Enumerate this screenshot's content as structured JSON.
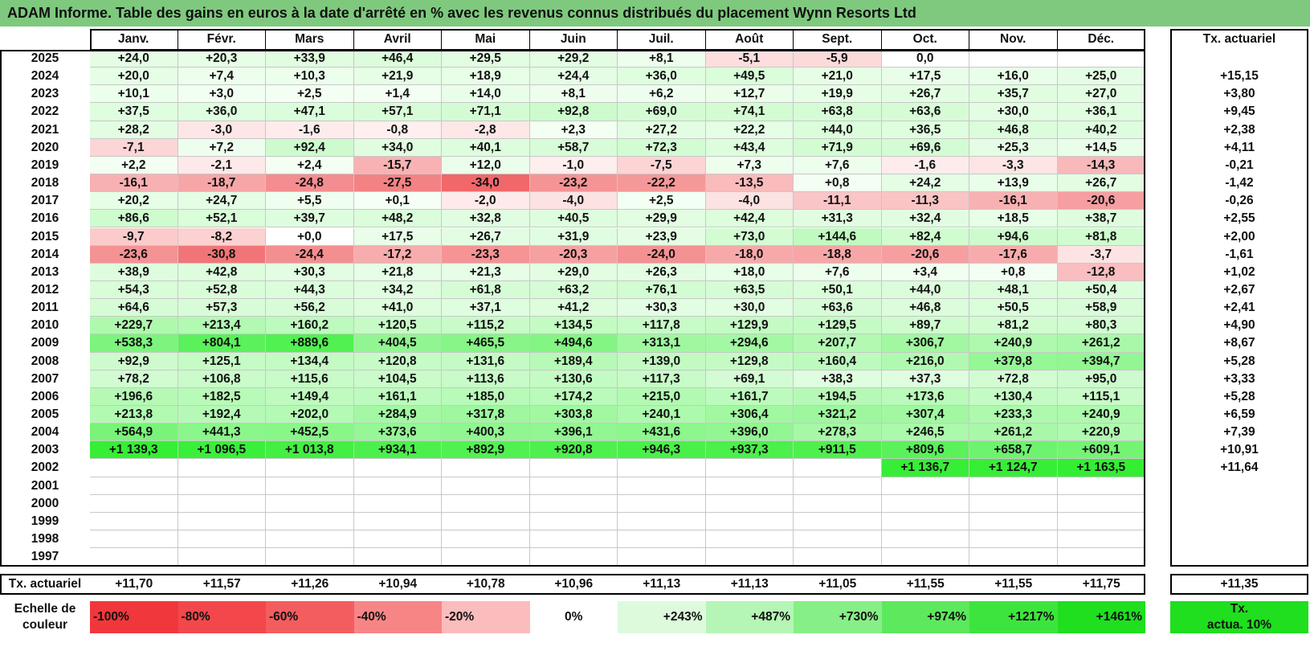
{
  "title": "ADAM Informe. Table des gains en euros à la date d'arrêté en % avec les revenus connus distribués du placement Wynn Resorts Ltd",
  "months": [
    "Janv.",
    "Févr.",
    "Mars",
    "Avril",
    "Mai",
    "Juin",
    "Juil.",
    "Août",
    "Sept.",
    "Oct.",
    "Nov.",
    "Déc."
  ],
  "actuarial_header": "Tx. actuariel",
  "rows": [
    {
      "year": "2025",
      "values": [
        "+24,0",
        "+20,3",
        "+33,9",
        "+46,4",
        "+29,5",
        "+29,2",
        "+8,1",
        "-5,1",
        "-5,9",
        "0,0",
        "",
        ""
      ],
      "rate": ""
    },
    {
      "year": "2024",
      "values": [
        "+20,0",
        "+7,4",
        "+10,3",
        "+21,9",
        "+18,9",
        "+24,4",
        "+36,0",
        "+49,5",
        "+21,0",
        "+17,5",
        "+16,0",
        "+25,0"
      ],
      "rate": "+15,15"
    },
    {
      "year": "2023",
      "values": [
        "+10,1",
        "+3,0",
        "+2,5",
        "+1,4",
        "+14,0",
        "+8,1",
        "+6,2",
        "+12,7",
        "+19,9",
        "+26,7",
        "+35,7",
        "+27,0"
      ],
      "rate": "+3,80"
    },
    {
      "year": "2022",
      "values": [
        "+37,5",
        "+36,0",
        "+47,1",
        "+57,1",
        "+71,1",
        "+92,8",
        "+69,0",
        "+74,1",
        "+63,8",
        "+63,6",
        "+30,0",
        "+36,1"
      ],
      "rate": "+9,45"
    },
    {
      "year": "2021",
      "values": [
        "+28,2",
        "-3,0",
        "-1,6",
        "-0,8",
        "-2,8",
        "+2,3",
        "+27,2",
        "+22,2",
        "+44,0",
        "+36,5",
        "+46,8",
        "+40,2"
      ],
      "rate": "+2,38"
    },
    {
      "year": "2020",
      "values": [
        "-7,1",
        "+7,2",
        "+92,4",
        "+34,0",
        "+40,1",
        "+58,7",
        "+72,3",
        "+43,4",
        "+71,9",
        "+69,6",
        "+25,3",
        "+14,5"
      ],
      "rate": "+4,11"
    },
    {
      "year": "2019",
      "values": [
        "+2,2",
        "-2,1",
        "+2,4",
        "-15,7",
        "+12,0",
        "-1,0",
        "-7,5",
        "+7,3",
        "+7,6",
        "-1,6",
        "-3,3",
        "-14,3"
      ],
      "rate": "-0,21"
    },
    {
      "year": "2018",
      "values": [
        "-16,1",
        "-18,7",
        "-24,8",
        "-27,5",
        "-34,0",
        "-23,2",
        "-22,2",
        "-13,5",
        "+0,8",
        "+24,2",
        "+13,9",
        "+26,7"
      ],
      "rate": "-1,42"
    },
    {
      "year": "2017",
      "values": [
        "+20,2",
        "+24,7",
        "+5,5",
        "+0,1",
        "-2,0",
        "-4,0",
        "+2,5",
        "-4,0",
        "-11,1",
        "-11,3",
        "-16,1",
        "-20,6"
      ],
      "rate": "-0,26"
    },
    {
      "year": "2016",
      "values": [
        "+86,6",
        "+52,1",
        "+39,7",
        "+48,2",
        "+32,8",
        "+40,5",
        "+29,9",
        "+42,4",
        "+31,3",
        "+32,4",
        "+18,5",
        "+38,7"
      ],
      "rate": "+2,55"
    },
    {
      "year": "2015",
      "values": [
        "-9,7",
        "-8,2",
        "+0,0",
        "+17,5",
        "+26,7",
        "+31,9",
        "+23,9",
        "+73,0",
        "+144,6",
        "+82,4",
        "+94,6",
        "+81,8"
      ],
      "rate": "+2,00"
    },
    {
      "year": "2014",
      "values": [
        "-23,6",
        "-30,8",
        "-24,4",
        "-17,2",
        "-23,3",
        "-20,3",
        "-24,0",
        "-18,0",
        "-18,8",
        "-20,6",
        "-17,6",
        "-3,7"
      ],
      "rate": "-1,61"
    },
    {
      "year": "2013",
      "values": [
        "+38,9",
        "+42,8",
        "+30,3",
        "+21,8",
        "+21,3",
        "+29,0",
        "+26,3",
        "+18,0",
        "+7,6",
        "+3,4",
        "+0,8",
        "-12,8"
      ],
      "rate": "+1,02"
    },
    {
      "year": "2012",
      "values": [
        "+54,3",
        "+52,8",
        "+44,3",
        "+34,2",
        "+61,8",
        "+63,2",
        "+76,1",
        "+63,5",
        "+50,1",
        "+44,0",
        "+48,1",
        "+50,4"
      ],
      "rate": "+2,67"
    },
    {
      "year": "2011",
      "values": [
        "+64,6",
        "+57,3",
        "+56,2",
        "+41,0",
        "+37,1",
        "+41,2",
        "+30,3",
        "+30,0",
        "+63,6",
        "+46,8",
        "+50,5",
        "+58,9"
      ],
      "rate": "+2,41"
    },
    {
      "year": "2010",
      "values": [
        "+229,7",
        "+213,4",
        "+160,2",
        "+120,5",
        "+115,2",
        "+134,5",
        "+117,8",
        "+129,9",
        "+129,5",
        "+89,7",
        "+81,2",
        "+80,3"
      ],
      "rate": "+4,90"
    },
    {
      "year": "2009",
      "values": [
        "+538,3",
        "+804,1",
        "+889,6",
        "+404,5",
        "+465,5",
        "+494,6",
        "+313,1",
        "+294,6",
        "+207,7",
        "+306,7",
        "+240,9",
        "+261,2"
      ],
      "rate": "+8,67"
    },
    {
      "year": "2008",
      "values": [
        "+92,9",
        "+125,1",
        "+134,4",
        "+120,8",
        "+131,6",
        "+189,4",
        "+139,0",
        "+129,8",
        "+160,4",
        "+216,0",
        "+379,8",
        "+394,7"
      ],
      "rate": "+5,28"
    },
    {
      "year": "2007",
      "values": [
        "+78,2",
        "+106,8",
        "+115,6",
        "+104,5",
        "+113,6",
        "+130,6",
        "+117,3",
        "+69,1",
        "+38,3",
        "+37,3",
        "+72,8",
        "+95,0"
      ],
      "rate": "+3,33"
    },
    {
      "year": "2006",
      "values": [
        "+196,6",
        "+182,5",
        "+149,4",
        "+161,1",
        "+185,0",
        "+174,2",
        "+215,0",
        "+161,7",
        "+194,5",
        "+173,6",
        "+130,4",
        "+115,1"
      ],
      "rate": "+5,28"
    },
    {
      "year": "2005",
      "values": [
        "+213,8",
        "+192,4",
        "+202,0",
        "+284,9",
        "+317,8",
        "+303,8",
        "+240,1",
        "+306,4",
        "+321,2",
        "+307,4",
        "+233,3",
        "+240,9"
      ],
      "rate": "+6,59"
    },
    {
      "year": "2004",
      "values": [
        "+564,9",
        "+441,3",
        "+452,5",
        "+373,6",
        "+400,3",
        "+396,1",
        "+431,6",
        "+396,0",
        "+278,3",
        "+246,5",
        "+261,2",
        "+220,9"
      ],
      "rate": "+7,39"
    },
    {
      "year": "2003",
      "values": [
        "+1 139,3",
        "+1 096,5",
        "+1 013,8",
        "+934,1",
        "+892,9",
        "+920,8",
        "+946,3",
        "+937,3",
        "+911,5",
        "+809,6",
        "+658,7",
        "+609,1"
      ],
      "rate": "+10,91"
    },
    {
      "year": "2002",
      "values": [
        "",
        "",
        "",
        "",
        "",
        "",
        "",
        "",
        "",
        "+1 136,7",
        "+1 124,7",
        "+1 163,5"
      ],
      "rate": "+11,64"
    },
    {
      "year": "2001",
      "values": [
        "",
        "",
        "",
        "",
        "",
        "",
        "",
        "",
        "",
        "",
        "",
        ""
      ],
      "rate": ""
    },
    {
      "year": "2000",
      "values": [
        "",
        "",
        "",
        "",
        "",
        "",
        "",
        "",
        "",
        "",
        "",
        ""
      ],
      "rate": ""
    },
    {
      "year": "1999",
      "values": [
        "",
        "",
        "",
        "",
        "",
        "",
        "",
        "",
        "",
        "",
        "",
        ""
      ],
      "rate": ""
    },
    {
      "year": "1998",
      "values": [
        "",
        "",
        "",
        "",
        "",
        "",
        "",
        "",
        "",
        "",
        "",
        ""
      ],
      "rate": ""
    },
    {
      "year": "1997",
      "values": [
        "",
        "",
        "",
        "",
        "",
        "",
        "",
        "",
        "",
        "",
        "",
        ""
      ],
      "rate": ""
    }
  ],
  "footer": {
    "label": "Tx. actuariel",
    "values": [
      "+11,70",
      "+11,57",
      "+11,26",
      "+10,94",
      "+10,78",
      "+10,96",
      "+11,13",
      "+11,13",
      "+11,05",
      "+11,55",
      "+11,55",
      "+11,75"
    ],
    "rate": "+11,35"
  },
  "scale": {
    "label_line1": "Echelle de",
    "label_line2": "couleur",
    "items": [
      {
        "text": "-100%",
        "color": "#f0383c"
      },
      {
        "text": "-80%",
        "color": "#f2484b"
      },
      {
        "text": "-60%",
        "color": "#f45d5f"
      },
      {
        "text": "-40%",
        "color": "#f88586"
      },
      {
        "text": "-20%",
        "color": "#fbbcbd"
      },
      {
        "text": "0%",
        "color": "#ffffff"
      },
      {
        "text": "+243%",
        "color": "#ddfadd"
      },
      {
        "text": "+487%",
        "color": "#b5f5b5"
      },
      {
        "text": "+730%",
        "color": "#87ef87"
      },
      {
        "text": "+974%",
        "color": "#5de95d"
      },
      {
        "text": "+1217%",
        "color": "#3ee43e"
      },
      {
        "text": "+1461%",
        "color": "#1fdf1f"
      }
    ],
    "rate_line1": "Tx.",
    "rate_line2": "actua. 10%",
    "rate_color": "#1fdf1f"
  },
  "colors": {
    "title_bg": "#7ec97e",
    "neg_max": "#f0686a",
    "pos_max": "#33ee33"
  }
}
